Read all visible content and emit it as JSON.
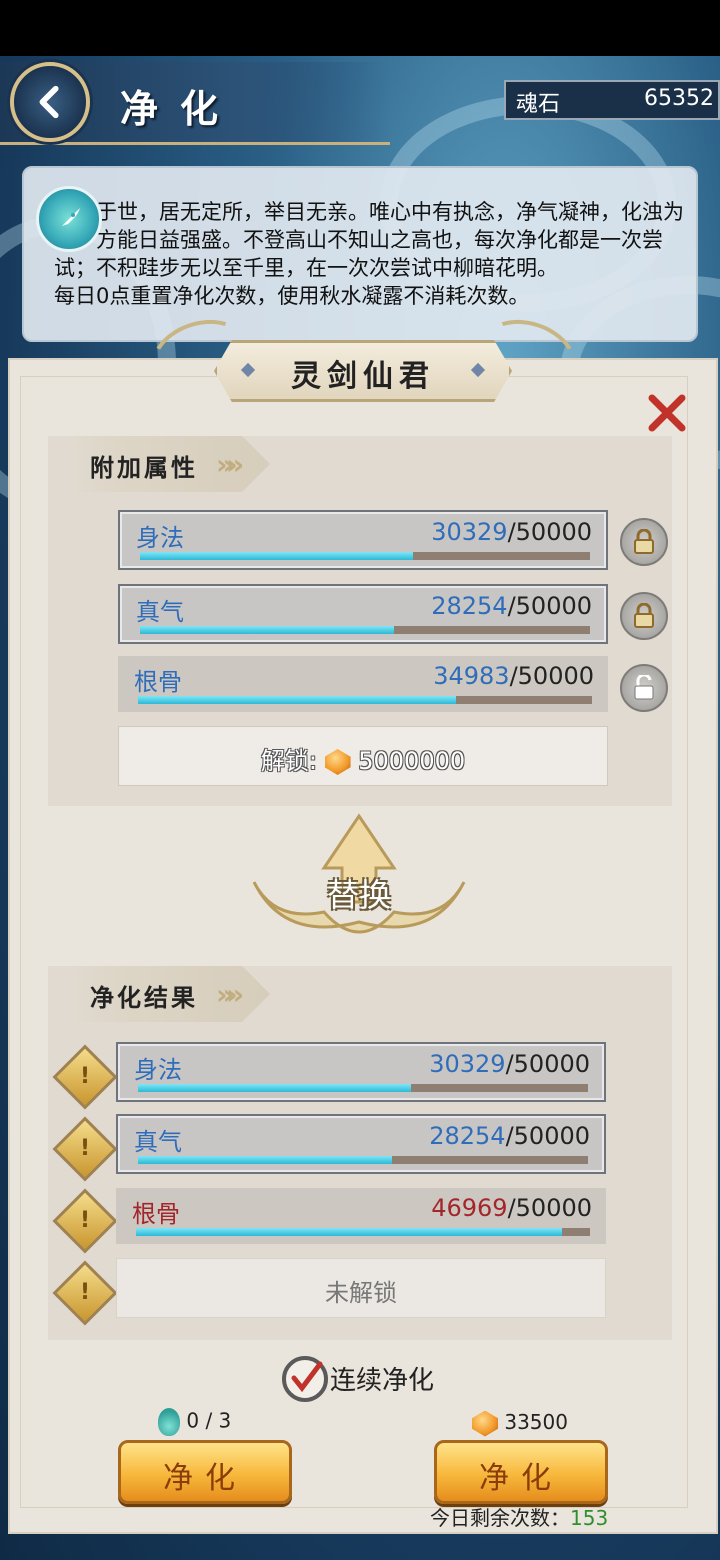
{
  "header": {
    "title": "净化",
    "currency_label": "魂石",
    "currency_value": "65352"
  },
  "description": "一孑于世，居无定所，举目无亲。唯心中有执念，净气凝神，化浊为清，方能日益强盛。不登高山不知山之高也，每次净化都是一次尝试；不积跬步无以至千里，在一次次尝试中柳暗花明。\n每日0点重置净化次数，使用秋水凝露不消耗次数。",
  "character_name": "灵剑仙君",
  "attributes": {
    "title": "附加属性",
    "items": [
      {
        "label": "身法",
        "current": "30329",
        "max": "/50000",
        "fraction": 0.6066,
        "locked": true
      },
      {
        "label": "真气",
        "current": "28254",
        "max": "/50000",
        "fraction": 0.5651,
        "locked": true
      },
      {
        "label": "根骨",
        "current": "34983",
        "max": "/50000",
        "fraction": 0.6997,
        "locked": false
      }
    ],
    "unlock_label": "解锁:",
    "unlock_cost": "5000000"
  },
  "swap_label": "替换",
  "results": {
    "title": "净化结果",
    "items": [
      {
        "label": "身法",
        "current": "30329",
        "max": "/50000",
        "fraction": 0.6066
      },
      {
        "label": "真气",
        "current": "28254",
        "max": "/50000",
        "fraction": 0.5651
      },
      {
        "label": "根骨",
        "current": "46969",
        "max": "/50000",
        "fraction": 0.9394
      }
    ],
    "locked_slot": "未解锁"
  },
  "continuous_label": "连续净化",
  "left_cost": "0 / 3",
  "right_cost": "33500",
  "purify_left_label": "净化",
  "purify_right_label": "净化",
  "remaining_label": "今日剩余次数：",
  "remaining_value": "153",
  "colors": {
    "bar_fill": "#2cb9d7",
    "improved_value": "#a3262b",
    "button": "#f7b83b",
    "remaining_count": "#2f8f2f"
  }
}
